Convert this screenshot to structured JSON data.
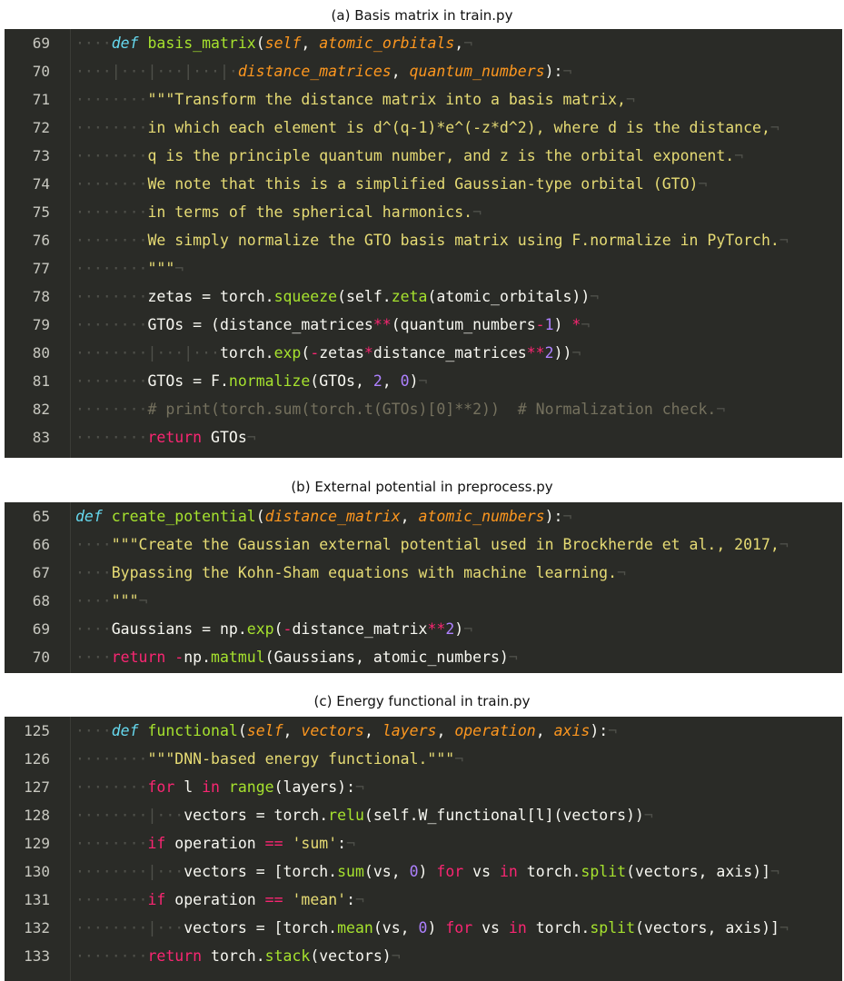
{
  "captions": {
    "a": "(a) Basis matrix in train.py",
    "b": "(b) External potential in preprocess.py",
    "c": "(c) Energy functional in train.py"
  },
  "panels": [
    {
      "id": "a",
      "lines": [
        {
          "n": "69",
          "tokens": [
            [
              "ws",
              "····"
            ],
            [
              "def",
              "def"
            ],
            [
              "t",
              " "
            ],
            [
              "fn",
              "basis_matrix"
            ],
            [
              "t",
              "("
            ],
            [
              "arg",
              "self"
            ],
            [
              "t",
              ", "
            ],
            [
              "arg",
              "atomic_orbitals"
            ],
            [
              "t",
              ","
            ],
            [
              "nl",
              "¬"
            ]
          ]
        },
        {
          "n": "70",
          "tokens": [
            [
              "ws",
              "····|···|···|···|·"
            ],
            [
              "arg",
              "distance_matrices"
            ],
            [
              "t",
              ", "
            ],
            [
              "arg",
              "quantum_numbers"
            ],
            [
              "t",
              "):"
            ],
            [
              "nl",
              "¬"
            ]
          ]
        },
        {
          "n": "71",
          "tokens": [
            [
              "ws",
              "········"
            ],
            [
              "str",
              "\"\"\"Transform the distance matrix into a basis matrix,"
            ],
            [
              "nl",
              "¬"
            ]
          ]
        },
        {
          "n": "72",
          "tokens": [
            [
              "ws",
              "········"
            ],
            [
              "str",
              "in which each element is d^(q-1)*e^(-z*d^2), where d is the distance,"
            ],
            [
              "nl",
              "¬"
            ]
          ]
        },
        {
          "n": "73",
          "tokens": [
            [
              "ws",
              "········"
            ],
            [
              "str",
              "q is the principle quantum number, and z is the orbital exponent."
            ],
            [
              "nl",
              "¬"
            ]
          ]
        },
        {
          "n": "74",
          "tokens": [
            [
              "ws",
              "········"
            ],
            [
              "str",
              "We note that this is a simplified Gaussian-type orbital (GTO)"
            ],
            [
              "nl",
              "¬"
            ]
          ]
        },
        {
          "n": "75",
          "tokens": [
            [
              "ws",
              "········"
            ],
            [
              "str",
              "in terms of the spherical harmonics."
            ],
            [
              "nl",
              "¬"
            ]
          ]
        },
        {
          "n": "76",
          "tokens": [
            [
              "ws",
              "········"
            ],
            [
              "str",
              "We simply normalize the GTO basis matrix using F.normalize in PyTorch."
            ],
            [
              "nl",
              "¬"
            ]
          ]
        },
        {
          "n": "77",
          "tokens": [
            [
              "ws",
              "········"
            ],
            [
              "str",
              "\"\"\""
            ],
            [
              "nl",
              "¬"
            ]
          ]
        },
        {
          "n": "78",
          "tokens": [
            [
              "ws",
              "········"
            ],
            [
              "t",
              "zetas = torch."
            ],
            [
              "fn",
              "squeeze"
            ],
            [
              "t",
              "(self."
            ],
            [
              "fn",
              "zeta"
            ],
            [
              "t",
              "(atomic_orbitals))"
            ],
            [
              "nl",
              "¬"
            ]
          ]
        },
        {
          "n": "79",
          "tokens": [
            [
              "ws",
              "········"
            ],
            [
              "t",
              "GTOs = (distance_matrices"
            ],
            [
              "kw",
              "**"
            ],
            [
              "t",
              "(quantum_numbers"
            ],
            [
              "kw",
              "-"
            ],
            [
              "num",
              "1"
            ],
            [
              "t",
              ") "
            ],
            [
              "kw",
              "*"
            ],
            [
              "nl",
              "¬"
            ]
          ]
        },
        {
          "n": "80",
          "tokens": [
            [
              "ws",
              "········|···|···"
            ],
            [
              "t",
              "torch."
            ],
            [
              "fn",
              "exp"
            ],
            [
              "t",
              "("
            ],
            [
              "kw",
              "-"
            ],
            [
              "t",
              "zetas"
            ],
            [
              "kw",
              "*"
            ],
            [
              "t",
              "distance_matrices"
            ],
            [
              "kw",
              "**"
            ],
            [
              "num",
              "2"
            ],
            [
              "t",
              "))"
            ],
            [
              "nl",
              "¬"
            ]
          ]
        },
        {
          "n": "81",
          "tokens": [
            [
              "ws",
              "········"
            ],
            [
              "t",
              "GTOs = F."
            ],
            [
              "fn",
              "normalize"
            ],
            [
              "t",
              "(GTOs, "
            ],
            [
              "num",
              "2"
            ],
            [
              "t",
              ", "
            ],
            [
              "num",
              "0"
            ],
            [
              "t",
              ")"
            ],
            [
              "nl",
              "¬"
            ]
          ]
        },
        {
          "n": "82",
          "tokens": [
            [
              "ws",
              "········"
            ],
            [
              "cm",
              "# print(torch.sum(torch.t(GTOs)[0]**2))  # Normalization check."
            ],
            [
              "nl",
              "¬"
            ]
          ]
        },
        {
          "n": "83",
          "tokens": [
            [
              "ws",
              "········"
            ],
            [
              "kw",
              "return"
            ],
            [
              "t",
              " GTOs"
            ],
            [
              "nl",
              "¬"
            ]
          ]
        }
      ]
    },
    {
      "id": "b",
      "lines": [
        {
          "n": "65",
          "tokens": [
            [
              "def",
              "def"
            ],
            [
              "t",
              " "
            ],
            [
              "fn",
              "create_potential"
            ],
            [
              "t",
              "("
            ],
            [
              "arg",
              "distance_matrix"
            ],
            [
              "t",
              ", "
            ],
            [
              "arg",
              "atomic_numbers"
            ],
            [
              "t",
              "):"
            ],
            [
              "nl",
              "¬"
            ]
          ]
        },
        {
          "n": "66",
          "tokens": [
            [
              "ws",
              "····"
            ],
            [
              "str",
              "\"\"\"Create the Gaussian external potential used in Brockherde et al., 2017,"
            ],
            [
              "nl",
              "¬"
            ]
          ]
        },
        {
          "n": "67",
          "tokens": [
            [
              "ws",
              "····"
            ],
            [
              "str",
              "Bypassing the Kohn-Sham equations with machine learning."
            ],
            [
              "nl",
              "¬"
            ]
          ]
        },
        {
          "n": "68",
          "tokens": [
            [
              "ws",
              "····"
            ],
            [
              "str",
              "\"\"\""
            ],
            [
              "nl",
              "¬"
            ]
          ]
        },
        {
          "n": "69",
          "tokens": [
            [
              "ws",
              "····"
            ],
            [
              "t",
              "Gaussians = np."
            ],
            [
              "fn",
              "exp"
            ],
            [
              "t",
              "("
            ],
            [
              "kw",
              "-"
            ],
            [
              "t",
              "distance_matrix"
            ],
            [
              "kw",
              "**"
            ],
            [
              "num",
              "2"
            ],
            [
              "t",
              ")"
            ],
            [
              "nl",
              "¬"
            ]
          ]
        },
        {
          "n": "70",
          "tokens": [
            [
              "ws",
              "····"
            ],
            [
              "kw",
              "return"
            ],
            [
              "t",
              " "
            ],
            [
              "kw",
              "-"
            ],
            [
              "t",
              "np."
            ],
            [
              "fn",
              "matmul"
            ],
            [
              "t",
              "(Gaussians, atomic_numbers)"
            ],
            [
              "nl",
              "¬"
            ]
          ]
        }
      ]
    },
    {
      "id": "c",
      "lines": [
        {
          "n": "125",
          "tokens": [
            [
              "ws",
              "····"
            ],
            [
              "def",
              "def"
            ],
            [
              "t",
              " "
            ],
            [
              "fn",
              "functional"
            ],
            [
              "t",
              "("
            ],
            [
              "arg",
              "self"
            ],
            [
              "t",
              ", "
            ],
            [
              "arg",
              "vectors"
            ],
            [
              "t",
              ", "
            ],
            [
              "arg",
              "layers"
            ],
            [
              "t",
              ", "
            ],
            [
              "arg",
              "operation"
            ],
            [
              "t",
              ", "
            ],
            [
              "arg",
              "axis"
            ],
            [
              "t",
              "):"
            ],
            [
              "nl",
              "¬"
            ]
          ]
        },
        {
          "n": "126",
          "tokens": [
            [
              "ws",
              "········"
            ],
            [
              "str",
              "\"\"\"DNN-based energy functional.\"\"\""
            ],
            [
              "nl",
              "¬"
            ]
          ]
        },
        {
          "n": "127",
          "tokens": [
            [
              "ws",
              "········"
            ],
            [
              "kw",
              "for"
            ],
            [
              "t",
              " l "
            ],
            [
              "kw",
              "in"
            ],
            [
              "t",
              " "
            ],
            [
              "fn",
              "range"
            ],
            [
              "t",
              "(layers):"
            ],
            [
              "nl",
              "¬"
            ]
          ]
        },
        {
          "n": "128",
          "tokens": [
            [
              "ws",
              "········|···"
            ],
            [
              "t",
              "vectors = torch."
            ],
            [
              "fn",
              "relu"
            ],
            [
              "t",
              "(self.W_functional[l](vectors))"
            ],
            [
              "nl",
              "¬"
            ]
          ]
        },
        {
          "n": "129",
          "tokens": [
            [
              "ws",
              "········"
            ],
            [
              "kw",
              "if"
            ],
            [
              "t",
              " operation "
            ],
            [
              "kw",
              "=="
            ],
            [
              "t",
              " "
            ],
            [
              "str",
              "'sum'"
            ],
            [
              "t",
              ":"
            ],
            [
              "nl",
              "¬"
            ]
          ]
        },
        {
          "n": "130",
          "tokens": [
            [
              "ws",
              "········|···"
            ],
            [
              "t",
              "vectors = [torch."
            ],
            [
              "fn",
              "sum"
            ],
            [
              "t",
              "(vs, "
            ],
            [
              "num",
              "0"
            ],
            [
              "t",
              ") "
            ],
            [
              "kw",
              "for"
            ],
            [
              "t",
              " vs "
            ],
            [
              "kw",
              "in"
            ],
            [
              "t",
              " torch."
            ],
            [
              "fn",
              "split"
            ],
            [
              "t",
              "(vectors, axis)]"
            ],
            [
              "nl",
              "¬"
            ]
          ]
        },
        {
          "n": "131",
          "tokens": [
            [
              "ws",
              "········"
            ],
            [
              "kw",
              "if"
            ],
            [
              "t",
              " operation "
            ],
            [
              "kw",
              "=="
            ],
            [
              "t",
              " "
            ],
            [
              "str",
              "'mean'"
            ],
            [
              "t",
              ":"
            ],
            [
              "nl",
              "¬"
            ]
          ]
        },
        {
          "n": "132",
          "tokens": [
            [
              "ws",
              "········|···"
            ],
            [
              "t",
              "vectors = [torch."
            ],
            [
              "fn",
              "mean"
            ],
            [
              "t",
              "(vs, "
            ],
            [
              "num",
              "0"
            ],
            [
              "t",
              ") "
            ],
            [
              "kw",
              "for"
            ],
            [
              "t",
              " vs "
            ],
            [
              "kw",
              "in"
            ],
            [
              "t",
              " torch."
            ],
            [
              "fn",
              "split"
            ],
            [
              "t",
              "(vectors, axis)]"
            ],
            [
              "nl",
              "¬"
            ]
          ]
        },
        {
          "n": "133",
          "tokens": [
            [
              "ws",
              "········"
            ],
            [
              "kw",
              "return"
            ],
            [
              "t",
              " torch."
            ],
            [
              "fn",
              "stack"
            ],
            [
              "t",
              "(vectors)"
            ],
            [
              "nl",
              "¬"
            ]
          ]
        }
      ]
    }
  ]
}
